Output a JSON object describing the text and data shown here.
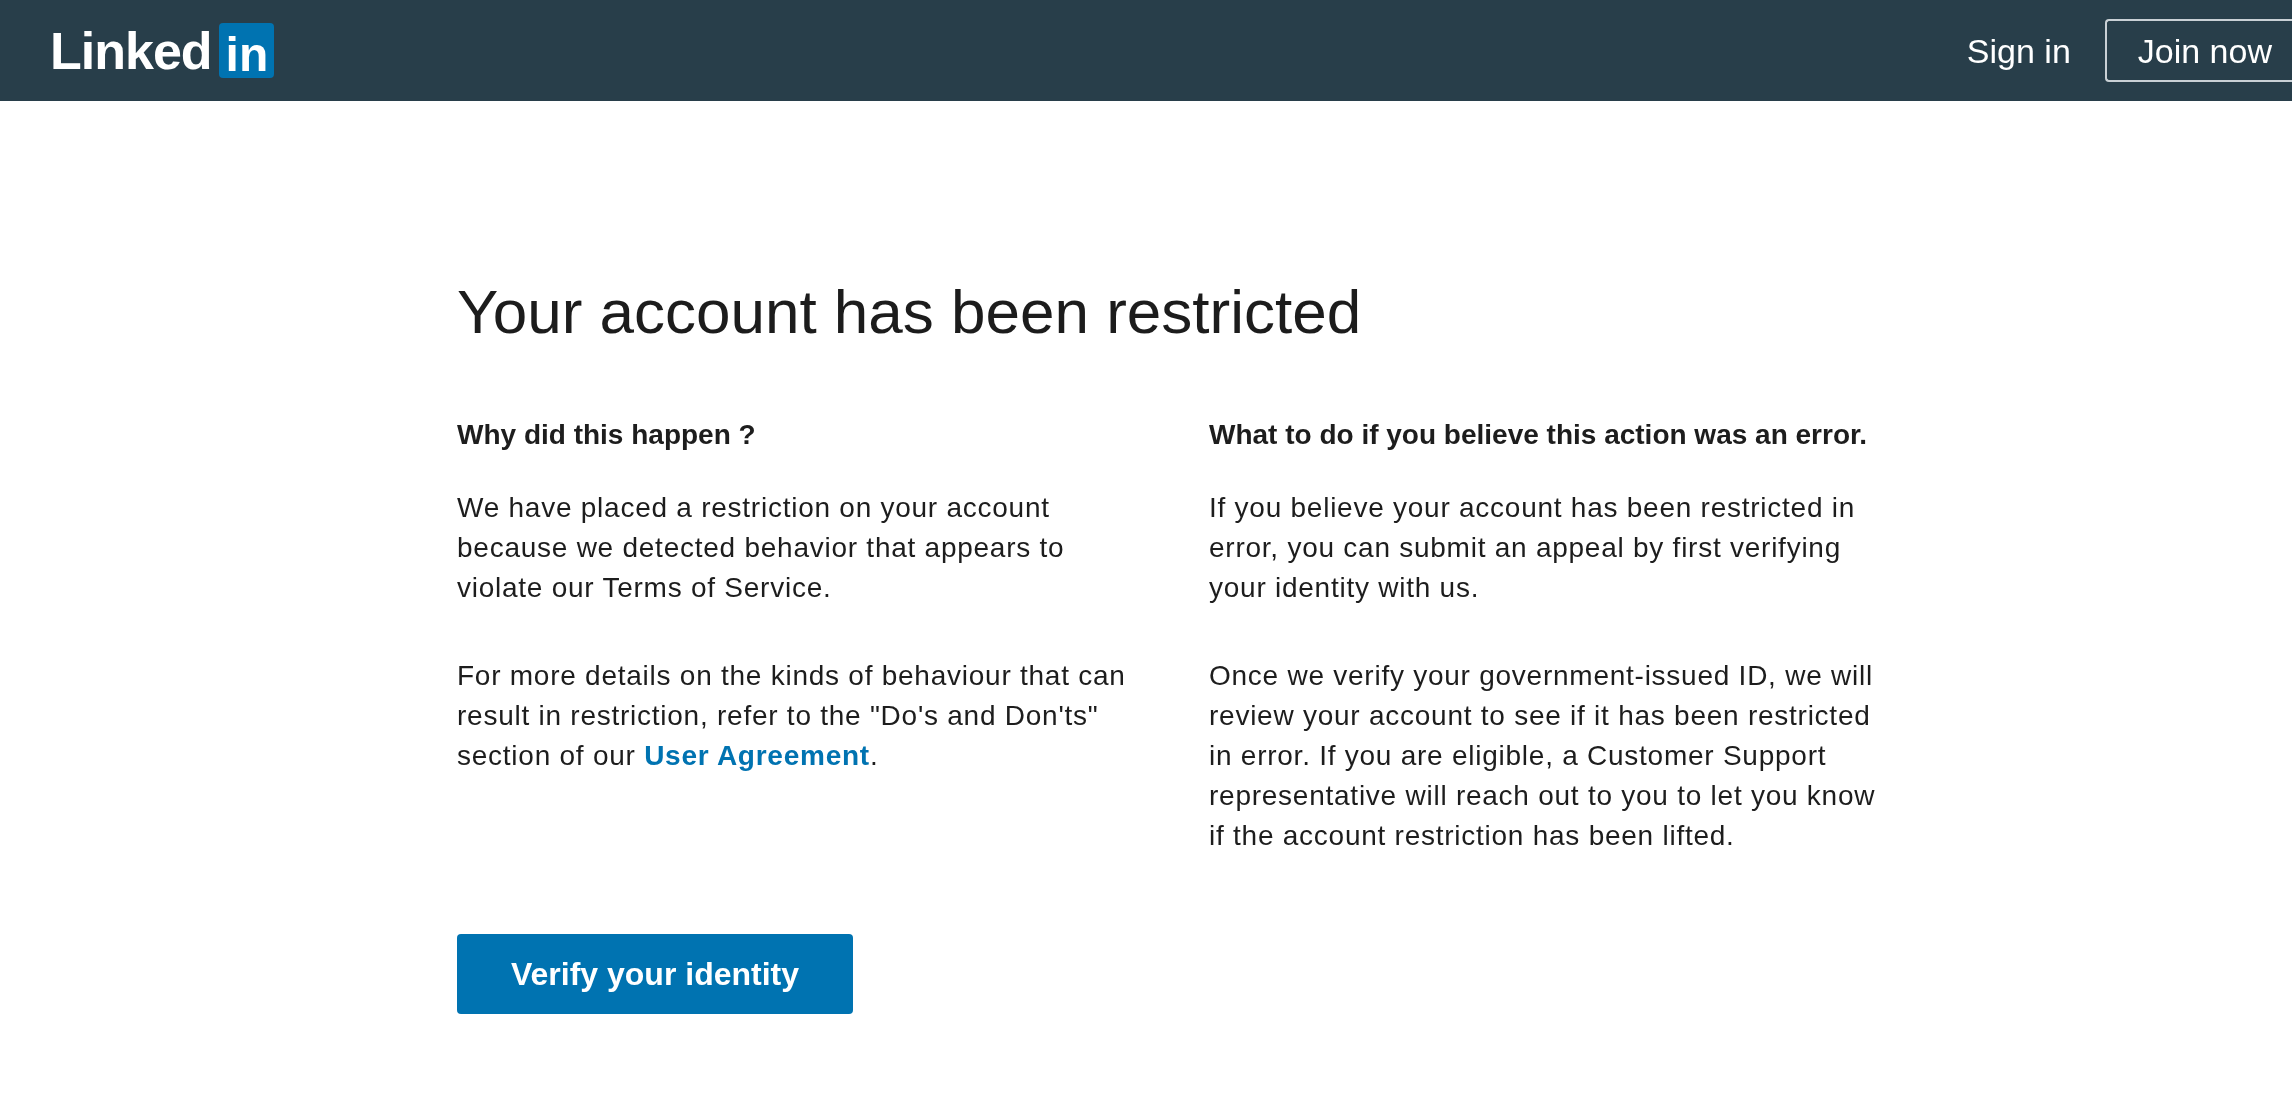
{
  "header": {
    "logo": {
      "wordmark": "Linked",
      "badge": "in"
    },
    "links": [
      {
        "kind": "link",
        "label": "Sign in"
      },
      {
        "kind": "outline_button",
        "label": "Join now"
      }
    ]
  },
  "page": {
    "title": "Your account has been restricted",
    "sections": [
      {
        "heading": "Why did this happen ?",
        "paragraphs": [
          {
            "parts": [
              {
                "kind": "text",
                "text": "We have placed a restriction on your account because we detected behavior that appears to violate our Terms of Service."
              }
            ]
          },
          {
            "parts": [
              {
                "kind": "text",
                "text": "For more details on the kinds of behaviour that can result in restriction, refer to the \"Do's and Don'ts\" section of our "
              },
              {
                "kind": "link",
                "text": "User Agreement"
              },
              {
                "kind": "text",
                "text": "."
              }
            ]
          }
        ]
      },
      {
        "heading": "What to do if you believe this action was an error.",
        "paragraphs": [
          {
            "parts": [
              {
                "kind": "text",
                "text": "If you believe your account has been restricted in error, you can submit an appeal by first verifying your identity with us."
              }
            ]
          },
          {
            "parts": [
              {
                "kind": "text",
                "text": "Once we verify your government-issued ID, we will review your account to see if it has been restricted in error. If you are eligible, a Customer Support representative will reach out to you to let you know if the account restriction has been lifted."
              }
            ]
          }
        ]
      }
    ],
    "primary_button": "Verify your identity"
  }
}
